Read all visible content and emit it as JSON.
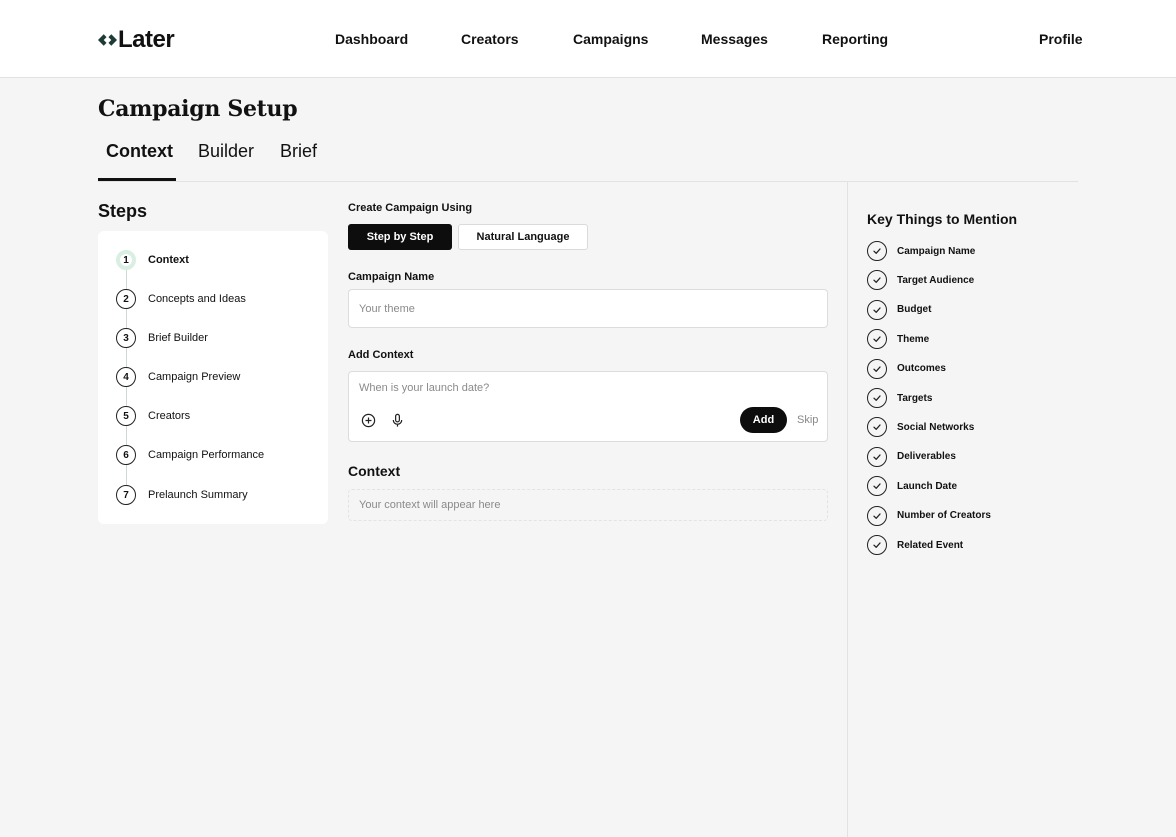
{
  "brand": {
    "name": "Later"
  },
  "nav": {
    "items": [
      "Dashboard",
      "Creators",
      "Campaigns",
      "Messages",
      "Reporting"
    ],
    "profile": "Profile"
  },
  "page": {
    "title": "Campaign Setup"
  },
  "tabs": [
    {
      "label": "Context",
      "active": true
    },
    {
      "label": "Builder",
      "active": false
    },
    {
      "label": "Brief",
      "active": false
    }
  ],
  "steps": {
    "title": "Steps",
    "items": [
      {
        "num": "1",
        "label": "Context",
        "active": true
      },
      {
        "num": "2",
        "label": "Concepts and Ideas"
      },
      {
        "num": "3",
        "label": "Brief Builder"
      },
      {
        "num": "4",
        "label": "Campaign Preview"
      },
      {
        "num": "5",
        "label": "Creators"
      },
      {
        "num": "6",
        "label": "Campaign Performance"
      },
      {
        "num": "7",
        "label": "Prelaunch Summary"
      }
    ]
  },
  "form": {
    "create_using_label": "Create Campaign Using",
    "mode_options": [
      "Step by Step",
      "Natural Language"
    ],
    "mode_selected": "Step by Step",
    "campaign_name_label": "Campaign Name",
    "campaign_name_placeholder": "Your theme",
    "add_context_label": "Add Context",
    "add_context_placeholder": "When is your launch date?",
    "add_button": "Add",
    "skip_button": "Skip",
    "context_heading": "Context",
    "context_output_placeholder": "Your context will appear here"
  },
  "key_things": {
    "title": "Key Things to Mention",
    "items": [
      "Campaign Name",
      "Target Audience",
      "Budget",
      "Theme",
      "Outcomes",
      "Targets",
      "Social Networks",
      "Deliverables",
      "Launch Date",
      "Number of Creators",
      "Related Event"
    ]
  },
  "colors": {
    "background": "#f5f5f5",
    "surface": "#ffffff",
    "primary": "#0d0d0d",
    "active_step_ring": "#d8efe2",
    "muted_text": "#888888",
    "border": "#dcdcdc"
  }
}
